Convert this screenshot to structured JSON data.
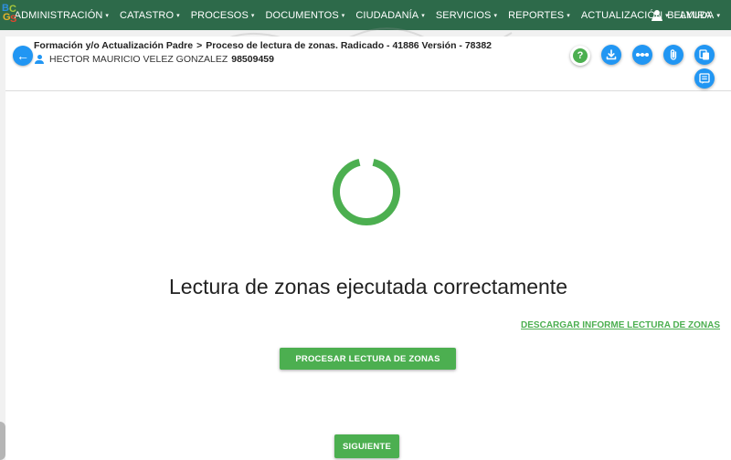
{
  "logo": {
    "letters": [
      "B",
      "C",
      "G",
      "S"
    ]
  },
  "nav": {
    "items": [
      {
        "label": "ADMINISTRACIÓN"
      },
      {
        "label": "CATASTRO"
      },
      {
        "label": "PROCESOS"
      },
      {
        "label": "DOCUMENTOS"
      },
      {
        "label": "CIUDADANÍA"
      },
      {
        "label": "SERVICIOS"
      },
      {
        "label": "REPORTES"
      },
      {
        "label": "ACTUALIZACIÓN"
      },
      {
        "label": "AYUDA"
      }
    ],
    "user": "BELMIRA",
    "caret": "▾"
  },
  "header": {
    "breadcrumb_parent": "Formación y/o Actualización Padre",
    "breadcrumb_separator": ">",
    "breadcrumb_current": "Proceso de lectura de zonas. Radicado - 41886 Versión - 78382",
    "person_name": "HECTOR MAURICIO VELEZ GONZALEZ",
    "person_id": "98509459",
    "back_glyph": "←",
    "help_glyph": "?",
    "toolbar_icons": [
      "help-icon",
      "download-icon",
      "more-horizontal-icon",
      "attach-icon",
      "copy-icon",
      "list-icon"
    ]
  },
  "main": {
    "status_message": "Lectura de zonas ejecutada correctamente",
    "report_link": "DESCARGAR INFORME LECTURA DE ZONAS",
    "process_button": "PROCESAR LECTURA DE ZONAS",
    "next_button": "SIGUIENTE"
  },
  "colors": {
    "nav_bg": "#2d6a4a",
    "accent_blue": "#2196f3",
    "accent_green": "#4caf50"
  }
}
